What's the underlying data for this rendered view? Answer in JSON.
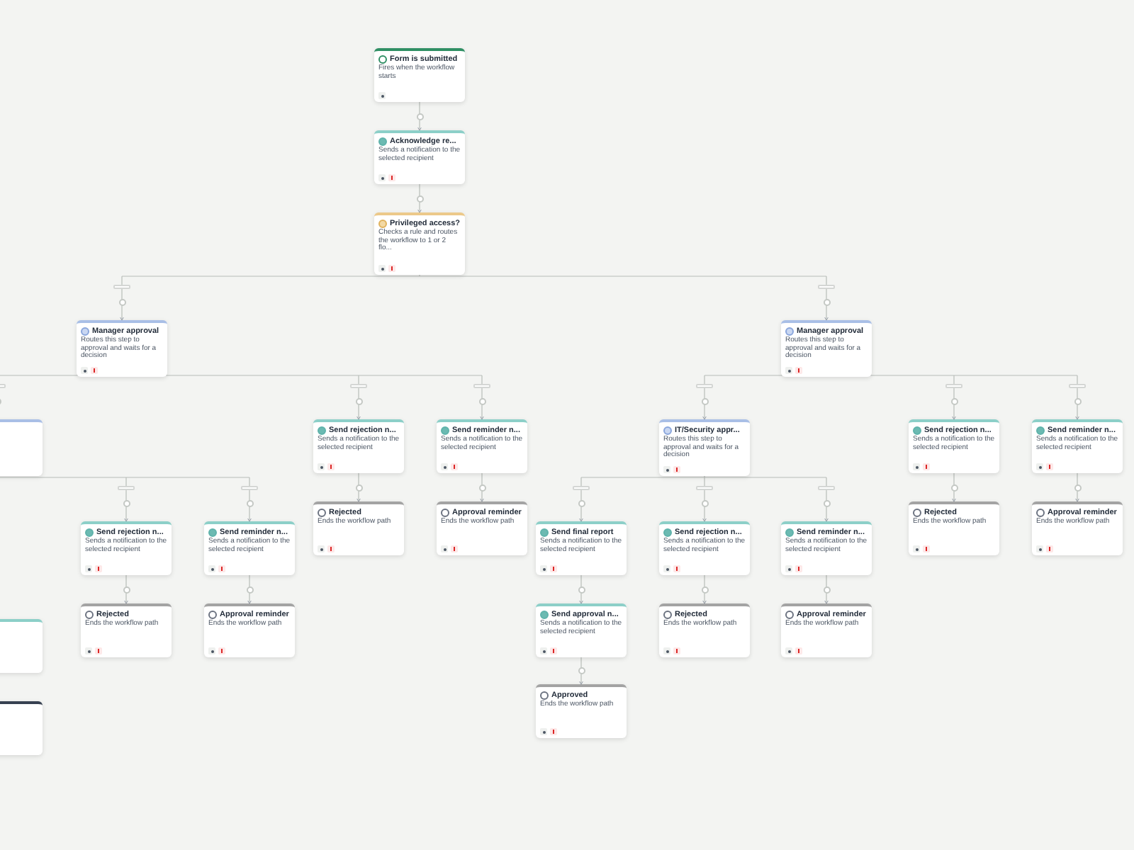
{
  "workflow": {
    "kind": "trigger",
    "title": "Form is submitted",
    "description": "Fires when the workflow starts",
    "children": [
      {
        "kind": "notification",
        "title": "Acknowledge re...",
        "description": "Sends a notification to the selected recipient",
        "children": [
          {
            "kind": "condition",
            "title": "Privileged access?",
            "description": "Checks a rule and routes the workflow to 1 or 2 flo...",
            "children": [
              {
                "kind": "approval",
                "title": "Manager approval",
                "description": "Routes this step to approval and waits for a decision",
                "children": [
                  {
                    "kind": "approval",
                    "children": [
                      {
                        "kind": "notification",
                        "title": "Send rejection n...",
                        "description": "Sends a notification to the selected recipient",
                        "children": [
                          {
                            "kind": "end",
                            "title": "Rejected",
                            "description": "Ends the workflow path"
                          }
                        ]
                      },
                      {
                        "kind": "notification",
                        "title": "Send reminder n...",
                        "description": "Sends a notification to the selected recipient",
                        "children": [
                          {
                            "kind": "end",
                            "title": "Approval reminder",
                            "description": "Ends the workflow path"
                          }
                        ]
                      }
                    ]
                  },
                  {
                    "kind": "notification",
                    "title": "Send rejection n...",
                    "description": "Sends a notification to the selected recipient",
                    "children": [
                      {
                        "kind": "end",
                        "title": "Rejected",
                        "description": "Ends the workflow path"
                      }
                    ]
                  },
                  {
                    "kind": "notification",
                    "title": "Send reminder n...",
                    "description": "Sends a notification to the selected recipient",
                    "children": [
                      {
                        "kind": "end",
                        "title": "Approval reminder",
                        "description": "Ends the workflow path"
                      }
                    ]
                  }
                ]
              },
              {
                "kind": "approval",
                "title": "Manager approval",
                "description": "Routes this step to approval and waits for a decision",
                "children": [
                  {
                    "kind": "approval",
                    "title": "IT/Security appr...",
                    "description": "Routes this step to approval and waits for a decision",
                    "children": [
                      {
                        "kind": "notification",
                        "title": "Send final report",
                        "description": "Sends a notification to the selected recipient",
                        "children": [
                          {
                            "kind": "notification",
                            "title": "Send approval n...",
                            "description": "Sends a notification to the selected recipient",
                            "children": [
                              {
                                "kind": "end",
                                "title": "Approved",
                                "description": "Ends the workflow path"
                              }
                            ]
                          }
                        ]
                      },
                      {
                        "kind": "notification",
                        "title": "Send rejection n...",
                        "description": "Sends a notification to the selected recipient",
                        "children": [
                          {
                            "kind": "end",
                            "title": "Rejected",
                            "description": "Ends the workflow path"
                          }
                        ]
                      },
                      {
                        "kind": "notification",
                        "title": "Send reminder n...",
                        "description": "Sends a notification to the selected recipient",
                        "children": [
                          {
                            "kind": "end",
                            "title": "Approval reminder",
                            "description": "Ends the workflow path"
                          }
                        ]
                      }
                    ]
                  },
                  {
                    "kind": "notification",
                    "title": "Send rejection n...",
                    "description": "Sends a notification to the selected recipient",
                    "children": [
                      {
                        "kind": "end",
                        "title": "Rejected",
                        "description": "Ends the workflow path"
                      }
                    ]
                  },
                  {
                    "kind": "notification",
                    "title": "Send reminder n...",
                    "description": "Sends a notification to the selected recipient",
                    "children": [
                      {
                        "kind": "end",
                        "title": "Approval reminder",
                        "description": "Ends the workflow path"
                      }
                    ]
                  }
                ]
              }
            ]
          }
        ]
      }
    ]
  }
}
